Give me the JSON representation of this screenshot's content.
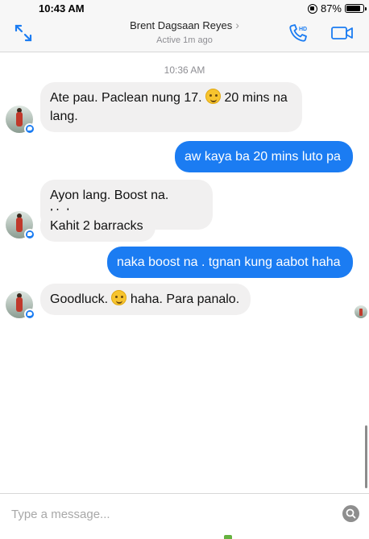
{
  "status_bar": {
    "time": "10:43 AM",
    "battery_text": "87%",
    "battery_level": 0.87
  },
  "header": {
    "contact_name": "Brent Dagsaan Reyes",
    "contact_status": "Active 1m ago",
    "icons": [
      "expand-icon",
      "phone-hd-icon",
      "video-camera-icon",
      "chevron-right-icon"
    ]
  },
  "thread": {
    "timestamp": "10:36 AM",
    "messages": [
      {
        "from": "them",
        "text": "Ate pau. Paclean nung 17. ",
        "emoji": "wink",
        "text2": " 20 mins na lang."
      },
      {
        "from": "me",
        "text": "aw kaya ba 20 mins luto pa"
      },
      {
        "from": "them",
        "text": "Ayon lang. Boost na. Haha"
      },
      {
        "from": "them",
        "text": "Kahit 2 barracks"
      },
      {
        "from": "me",
        "text": "naka boost na . tgnan kung aabot haha"
      },
      {
        "from": "them",
        "text": "Goodluck. ",
        "emoji": "smile",
        "text2": " haha. Para panalo."
      }
    ]
  },
  "composer": {
    "placeholder": "Type a message..."
  },
  "colors": {
    "accent": "#1b7cf2",
    "incoming_bubble": "#f1f0f0",
    "header_bg": "#f7f7f7"
  }
}
